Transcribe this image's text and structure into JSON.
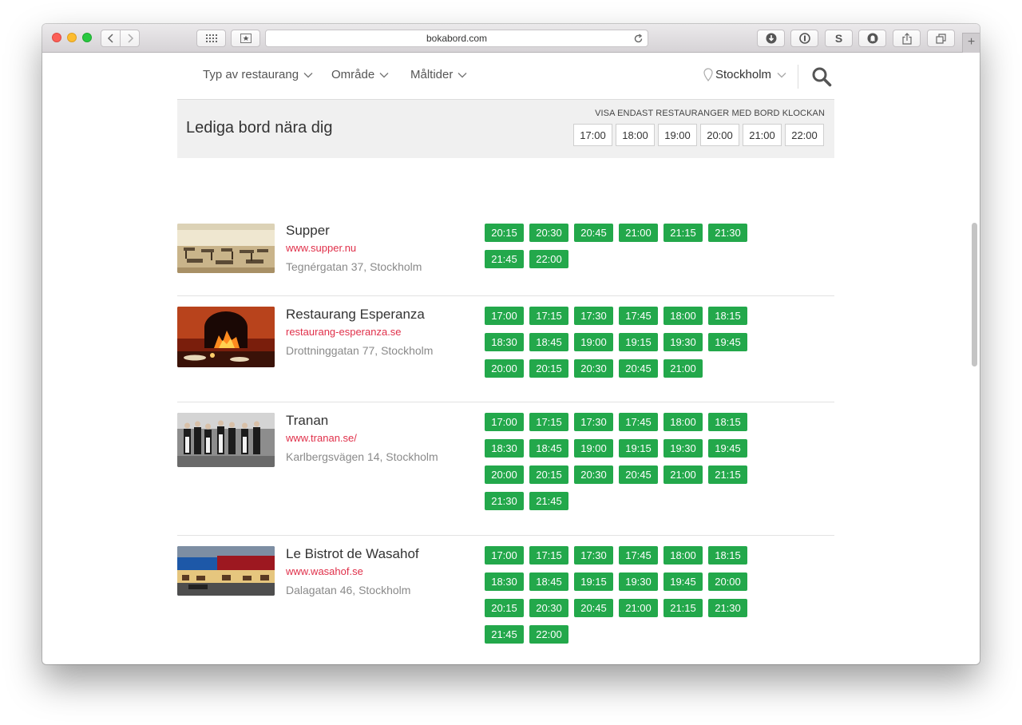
{
  "browser": {
    "url": "bokabord.com"
  },
  "nav": {
    "items": [
      {
        "label": "Typ av restaurang"
      },
      {
        "label": "Område"
      },
      {
        "label": "Måltider"
      }
    ],
    "location": "Stockholm"
  },
  "banner": {
    "title": "Lediga bord nära dig",
    "filter_label": "VISA ENDAST RESTAURANGER MED BORD KLOCKAN",
    "times": [
      "17:00",
      "18:00",
      "19:00",
      "20:00",
      "21:00",
      "22:00"
    ]
  },
  "restaurants": [
    {
      "name": "Supper",
      "url": "www.supper.nu",
      "address": "Tegnérgatan 37, Stockholm",
      "slots": [
        "20:15",
        "20:30",
        "20:45",
        "21:00",
        "21:15",
        "21:30",
        "21:45",
        "22:00"
      ]
    },
    {
      "name": "Restaurang Esperanza",
      "url": "restaurang-esperanza.se",
      "address": "Drottninggatan 77, Stockholm",
      "slots": [
        "17:00",
        "17:15",
        "17:30",
        "17:45",
        "18:00",
        "18:15",
        "18:30",
        "18:45",
        "19:00",
        "19:15",
        "19:30",
        "19:45",
        "20:00",
        "20:15",
        "20:30",
        "20:45",
        "21:00"
      ]
    },
    {
      "name": "Tranan",
      "url": "www.tranan.se/",
      "address": "Karlbergsvägen 14, Stockholm",
      "slots": [
        "17:00",
        "17:15",
        "17:30",
        "17:45",
        "18:00",
        "18:15",
        "18:30",
        "18:45",
        "19:00",
        "19:15",
        "19:30",
        "19:45",
        "20:00",
        "20:15",
        "20:30",
        "20:45",
        "21:00",
        "21:15",
        "21:30",
        "21:45"
      ]
    },
    {
      "name": "Le Bistrot de Wasahof",
      "url": "www.wasahof.se",
      "address": "Dalagatan 46, Stockholm",
      "slots": [
        "17:00",
        "17:15",
        "17:30",
        "17:45",
        "18:00",
        "18:15",
        "18:30",
        "18:45",
        "19:15",
        "19:30",
        "19:45",
        "20:00",
        "20:15",
        "20:30",
        "20:45",
        "21:00",
        "21:15",
        "21:30",
        "21:45",
        "22:00"
      ]
    }
  ],
  "colors": {
    "slot_green": "#23a84b",
    "link_red": "#e0304a"
  }
}
